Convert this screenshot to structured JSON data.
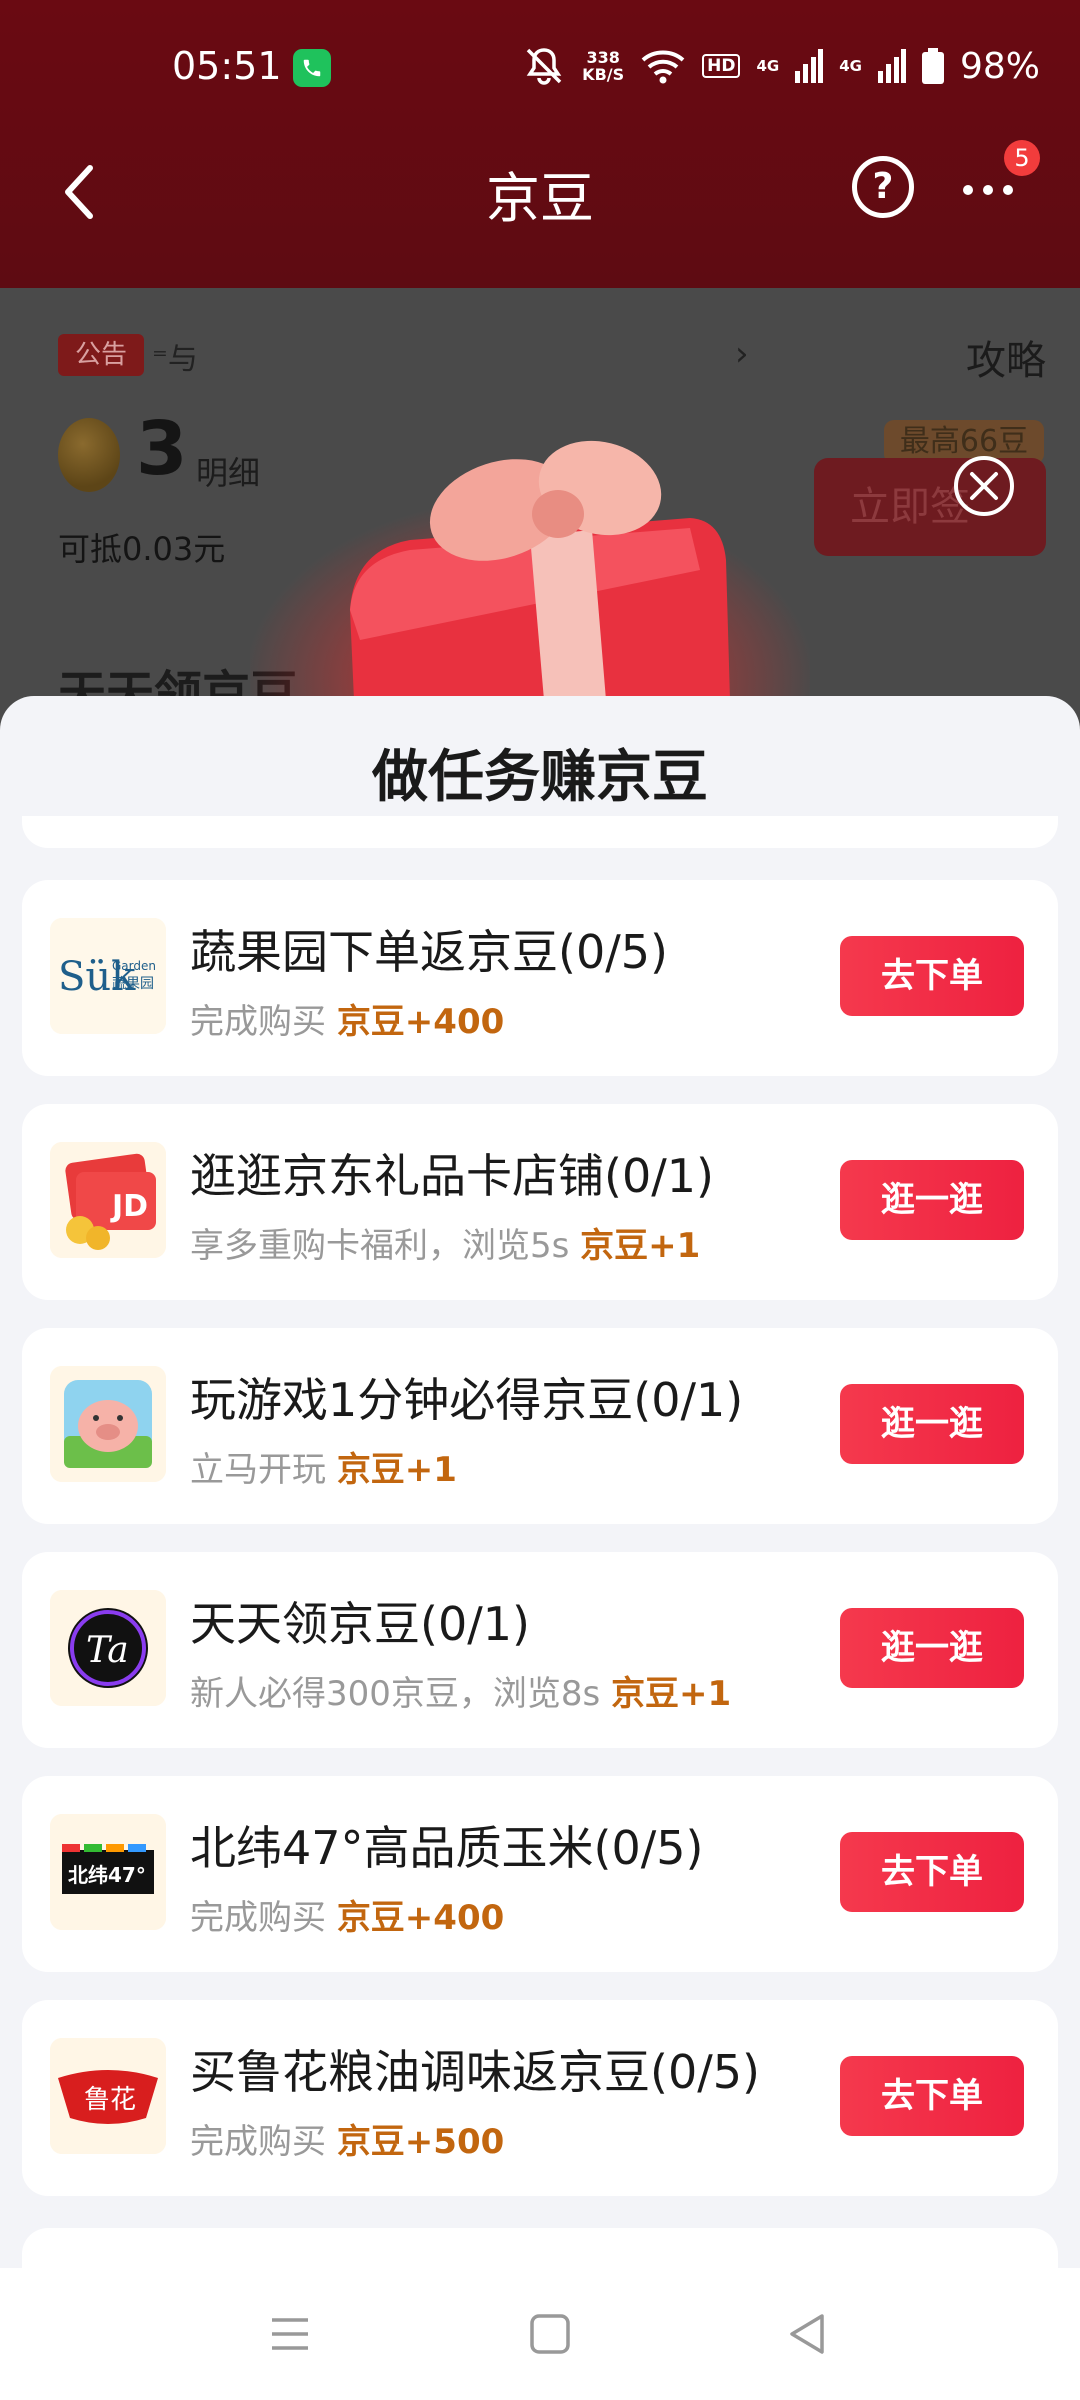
{
  "status_bar": {
    "time": "05:51",
    "net_speed_value": "338",
    "net_speed_unit": "KB/S",
    "hd_label": "HD",
    "signal_label_1": "4G",
    "signal_label_2": "4G",
    "battery": "98%"
  },
  "header": {
    "title": "京豆",
    "help_label": "?",
    "badge_count": "5"
  },
  "background_page": {
    "notice_tag": "公告",
    "notice_text": "⁼与",
    "notice_arrow": "›",
    "strategy_link": "攻略",
    "bean_count": "3",
    "detail_link": "明细",
    "worth_text": "可抵0.03元",
    "max_tag": "最高66豆",
    "sign_button": "立即签",
    "daily_heading": "天天领京豆"
  },
  "sheet": {
    "title": "做任务赚京豆",
    "tasks": [
      {
        "name": "蔬果园下单返京豆(0/5)",
        "desc": "完成购买",
        "reward": "京豆+400",
        "button": "去下单",
        "logo_text": "Sük",
        "logo_sub_1": "Garden",
        "logo_sub_2": "蔬果园"
      },
      {
        "name": "逛逛京东礼品卡店铺(0/1)",
        "desc": "享多重购卡福利，浏览5s",
        "reward": "京豆+1",
        "button": "逛一逛",
        "logo_text": "JD"
      },
      {
        "name": "玩游戏1分钟必得京豆(0/1)",
        "desc": "立马开玩",
        "reward": "京豆+1",
        "button": "逛一逛"
      },
      {
        "name": "天天领京豆(0/1)",
        "desc": "新人必得300京豆，浏览8s",
        "reward": "京豆+1",
        "button": "逛一逛",
        "logo_text": "Ta"
      },
      {
        "name": "北纬47°高品质玉米(0/5)",
        "desc": "完成购买",
        "reward": "京豆+400",
        "button": "去下单",
        "logo_text": "北纬47°"
      },
      {
        "name": "买鲁花粮油调味返京豆(0/5)",
        "desc": "完成购买",
        "reward": "京豆+500",
        "button": "去下单",
        "logo_text": "鲁花"
      }
    ]
  },
  "colors": {
    "header_bg": "#6a0a12",
    "button_red": "#f5394d",
    "reward_orange": "#c2660f"
  }
}
